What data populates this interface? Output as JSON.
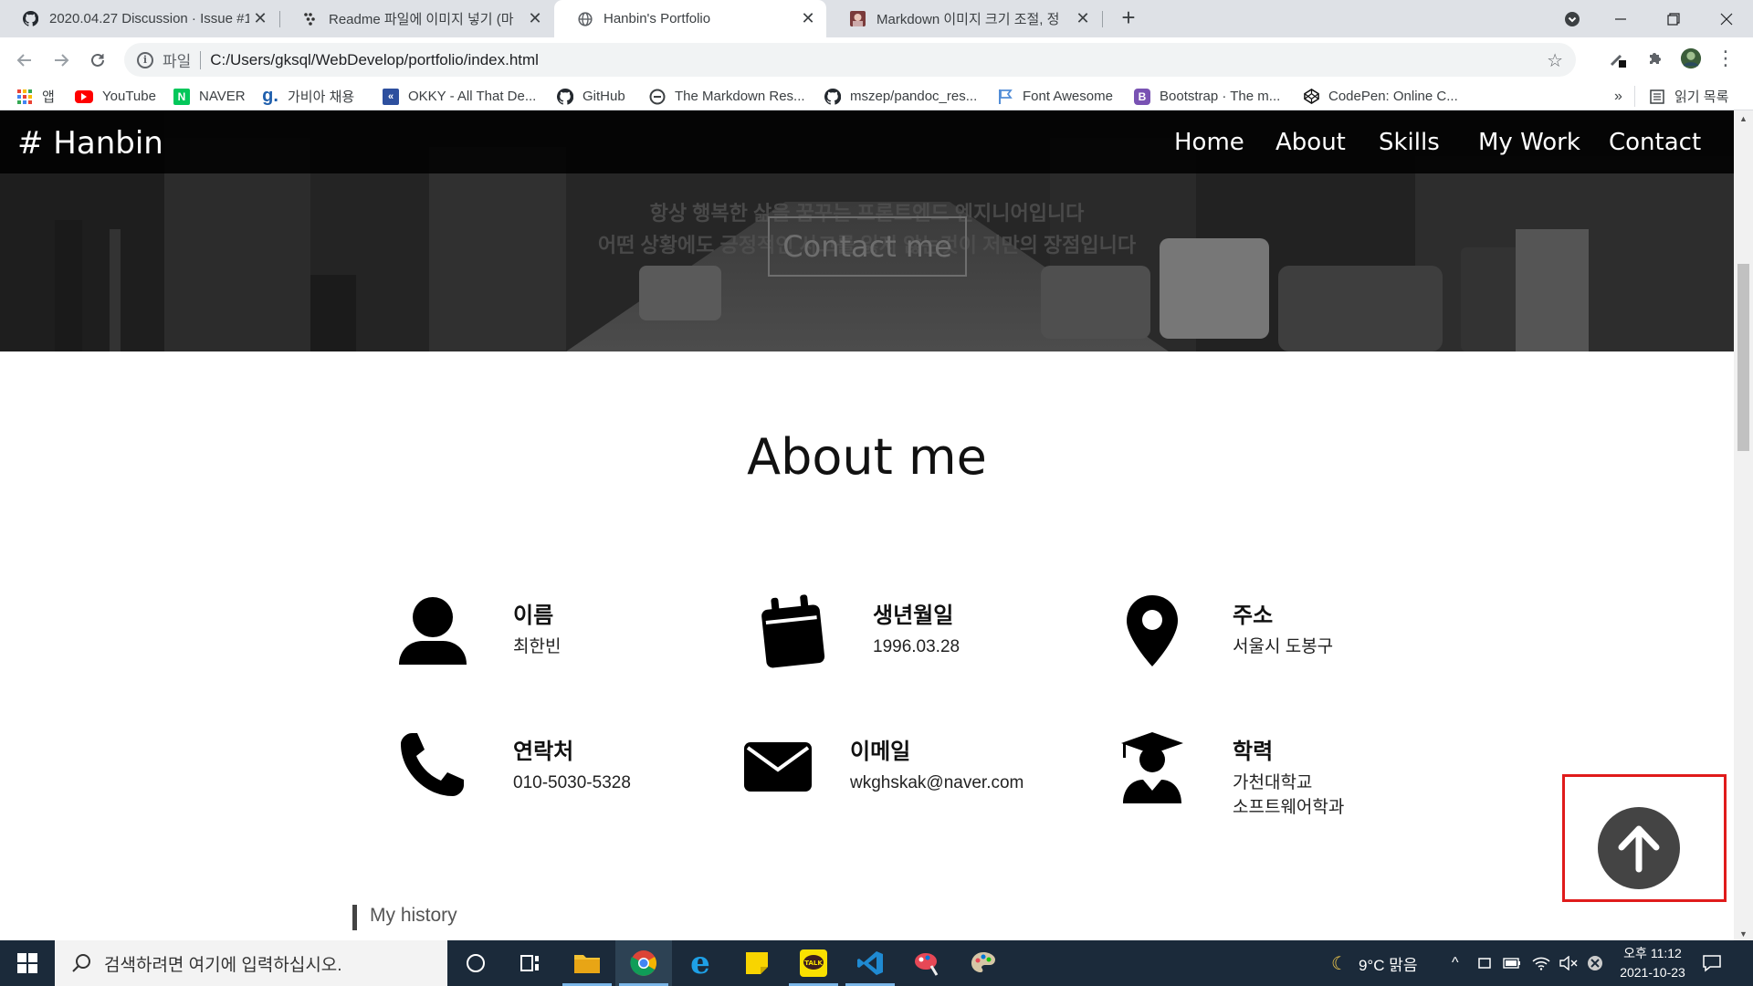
{
  "browser": {
    "tabs": [
      {
        "title": "2020.04.27 Discussion · Issue #1",
        "icon": "github-icon"
      },
      {
        "title": "Readme 파일에 이미지 넣기 (마",
        "icon": "velog-icon"
      },
      {
        "title": "Hanbin's Portfolio",
        "icon": "globe-icon",
        "active": true
      },
      {
        "title": "Markdown 이미지 크기 조절, 정",
        "icon": "blog-avatar-icon"
      }
    ],
    "address_scheme": "파일",
    "address_url": "C:/Users/gksql/WebDevelop/portfolio/index.html",
    "bookmarks": [
      {
        "label": "앱",
        "icon": "apps-grid-icon"
      },
      {
        "label": "YouTube",
        "icon": "youtube-icon",
        "color": "#ff0000"
      },
      {
        "label": "NAVER",
        "icon": "naver-icon",
        "color": "#03c75a"
      },
      {
        "label": "가비아 채용",
        "icon": "gabia-icon",
        "color": "#1f5fad"
      },
      {
        "label": "OKKY - All That De...",
        "icon": "okky-icon",
        "color": "#2d4f9e"
      },
      {
        "label": "GitHub",
        "icon": "github-icon"
      },
      {
        "label": "The Markdown Res...",
        "icon": "markdown-guide-icon"
      },
      {
        "label": "mszep/pandoc_res...",
        "icon": "github-icon"
      },
      {
        "label": "Font Awesome",
        "icon": "flag-icon",
        "color": "#528dd7"
      },
      {
        "label": "Bootstrap · The m...",
        "icon": "bootstrap-icon",
        "color": "#7952b3"
      },
      {
        "label": "CodePen: Online C...",
        "icon": "codepen-icon"
      }
    ],
    "bookmarks_overflow": "»",
    "reading_list": "읽기 목록"
  },
  "page": {
    "logo": "# Hanbin",
    "nav": [
      "Home",
      "About",
      "Skills",
      "My Work",
      "Contact"
    ],
    "hero_quote_1": "항상 행복한 삶을 꿈꾸는 프론트엔드 엔지니어입니다",
    "hero_quote_2": "어떤 상황에도 긍정적인 사고를 잃지 않는것이 저만의 장점입니다",
    "hero_button": "Contact me",
    "about_title": "About me",
    "info": [
      {
        "label": "이름",
        "value": "최한빈",
        "icon": "user-icon"
      },
      {
        "label": "생년월일",
        "value": "1996.03.28",
        "icon": "calendar-icon"
      },
      {
        "label": "주소",
        "value": "서울시 도봉구",
        "icon": "map-marker-icon"
      },
      {
        "label": "연락처",
        "value": "010-5030-5328",
        "icon": "phone-icon"
      },
      {
        "label": "이메일",
        "value": "wkghskak@naver.com",
        "icon": "envelope-icon"
      },
      {
        "label": "학력",
        "value_1": "가천대학교",
        "value_2": "소프트웨어학과",
        "icon": "graduate-icon"
      }
    ],
    "history_title": "My history",
    "scroll_top_icon": "arrow-up-icon",
    "highlight_color": "#e01b1b"
  },
  "taskbar": {
    "search_placeholder": "검색하려면 여기에 입력하십시오.",
    "weather": "9°C  맑음",
    "time": "오후 11:12",
    "date": "2021-10-23"
  }
}
